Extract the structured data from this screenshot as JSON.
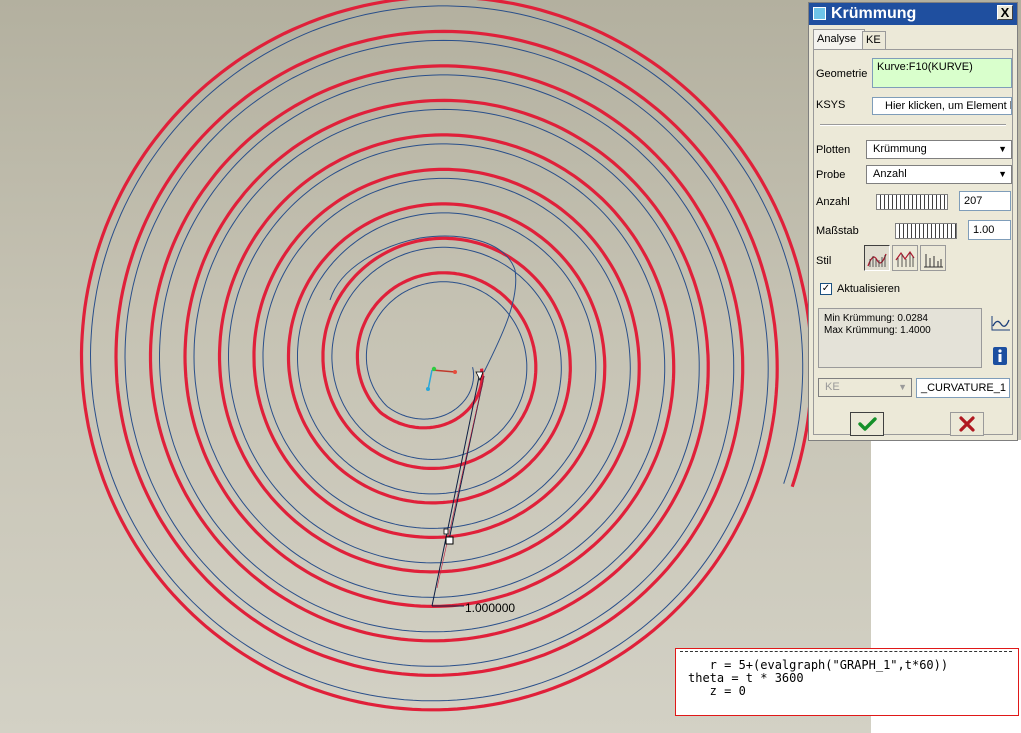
{
  "dialog": {
    "title": "Krümmung",
    "close_label": "X",
    "tabs": [
      {
        "label": "Analyse"
      },
      {
        "label": "KE"
      }
    ],
    "geometry": {
      "label": "Geometrie",
      "value": "Kurve:F10(KURVE)"
    },
    "ksys": {
      "label": "KSYS",
      "value": "Hier klicken, um Element hi"
    },
    "plot": {
      "label": "Plotten",
      "value": "Krümmung"
    },
    "sample": {
      "label": "Probe",
      "value": "Anzahl"
    },
    "count": {
      "label": "Anzahl",
      "value": "207"
    },
    "scale": {
      "label": "Maßstab",
      "value": "1.00"
    },
    "style": {
      "label": "Stil",
      "selected_index": 0
    },
    "update": {
      "label": "Aktualisieren",
      "checked": true
    },
    "results": {
      "min": "Min Krümmung: 0.0284",
      "max": "Max Krümmung: 1.4000"
    },
    "ke_combo": "KE",
    "feature_name": "_CURVATURE_1"
  },
  "viewport": {
    "dimension_label": "1.000000",
    "curve_color": "#e0203a",
    "porcupine_color": "#2a4f8a"
  },
  "relations": {
    "lines": [
      "   r = 5+(evalgraph(\"GRAPH_1\",t*60))",
      "theta = t * 3600",
      "   z = 0"
    ]
  }
}
